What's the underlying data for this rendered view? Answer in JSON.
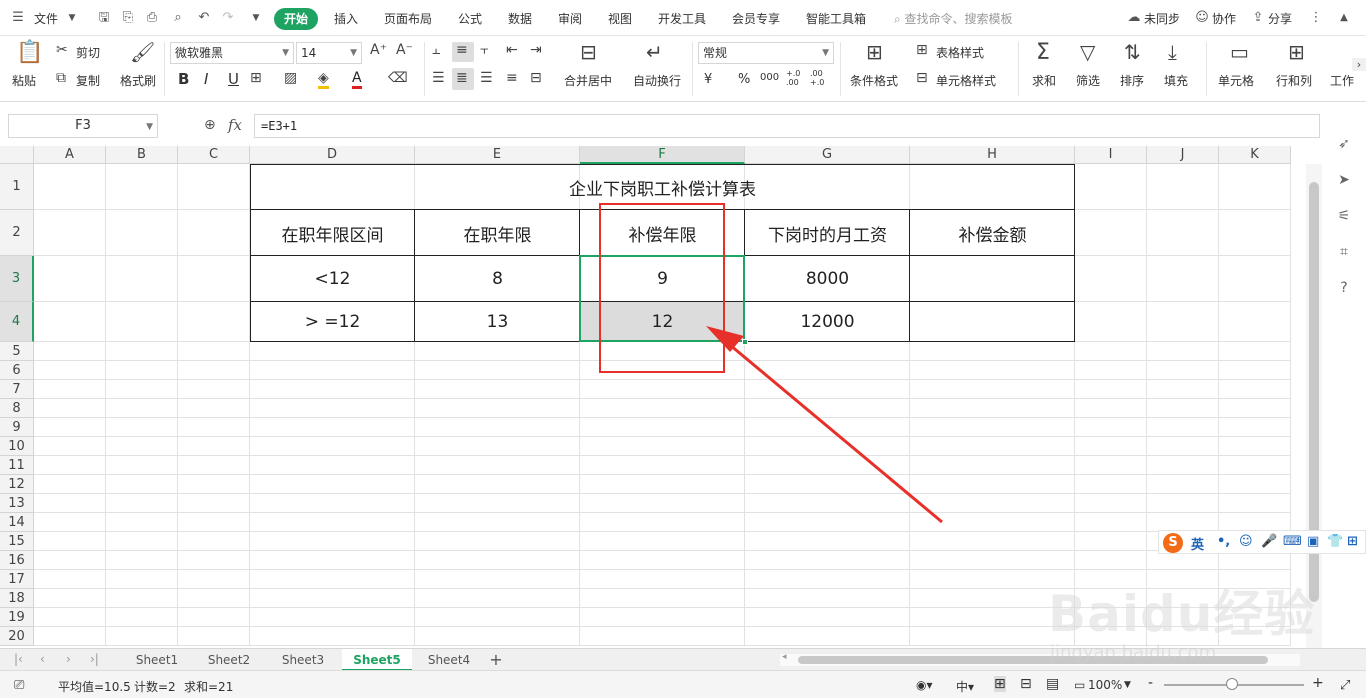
{
  "menubar": {
    "file_label": "文件",
    "tabs": [
      "开始",
      "插入",
      "页面布局",
      "公式",
      "数据",
      "审阅",
      "视图",
      "开发工具",
      "会员专享",
      "智能工具箱"
    ],
    "active_tab": "开始",
    "search_placeholder": "查找命令、搜索模板",
    "sync_label": "未同步",
    "collab_label": "协作",
    "share_label": "分享"
  },
  "ribbon": {
    "paste": "粘贴",
    "cut": "剪切",
    "copy": "复制",
    "format_painter": "格式刷",
    "font_name": "微软雅黑",
    "font_size": "14",
    "bold": "B",
    "italic": "I",
    "underline": "U",
    "merge_center": "合并居中",
    "wrap_text": "自动换行",
    "number_format": "常规",
    "currency": "¥",
    "percent": "%",
    "thousands": "000",
    "inc_decimal": "+.0 .00",
    "dec_decimal": ".00 +.0",
    "cond_format": "条件格式",
    "table_style": "表格样式",
    "cell_style": "单元格样式",
    "sum": "求和",
    "filter": "筛选",
    "sort": "排序",
    "fill": "填充",
    "cell": "单元格",
    "row_col": "行和列",
    "worksheet": "工作"
  },
  "formula_bar": {
    "name_box": "F3",
    "fx": "fx",
    "formula": "=E3+1"
  },
  "grid": {
    "columns": [
      "A",
      "B",
      "C",
      "D",
      "E",
      "F",
      "G",
      "H",
      "I",
      "J",
      "K"
    ],
    "rows": [
      "1",
      "2",
      "3",
      "4",
      "5",
      "6",
      "7",
      "8",
      "9",
      "10",
      "11",
      "12",
      "13",
      "14",
      "15",
      "16",
      "17",
      "18",
      "19",
      "20"
    ],
    "selected_column": "F",
    "selected_rows": [
      "3",
      "4"
    ],
    "title": "企业下岗职工补偿计算表",
    "headers": [
      "在职年限区间",
      "在职年限",
      "补偿年限",
      "下岗时的月工资",
      "补偿金额"
    ],
    "rows_data": [
      [
        "<12",
        "8",
        "9",
        "8000",
        ""
      ],
      [
        "> =12",
        "13",
        "12",
        "12000",
        ""
      ]
    ]
  },
  "sheets": {
    "tabs": [
      "Sheet1",
      "Sheet2",
      "Sheet3",
      "Sheet5",
      "Sheet4"
    ],
    "active": "Sheet5",
    "add": "+"
  },
  "statusbar": {
    "average": "平均值=10.5",
    "count": "计数=2",
    "sum": "求和=21",
    "zoom": "100%",
    "zoom_minus": "-",
    "zoom_plus": "+"
  },
  "ime": {
    "logo": "S",
    "mode": "英"
  },
  "watermark": {
    "brand": "Baidu经验",
    "url": "jingyan.baidu.com"
  },
  "colors": {
    "accent": "#1ea362",
    "annotation": "#e8302a",
    "selection_fill": "#dcdcdc"
  }
}
